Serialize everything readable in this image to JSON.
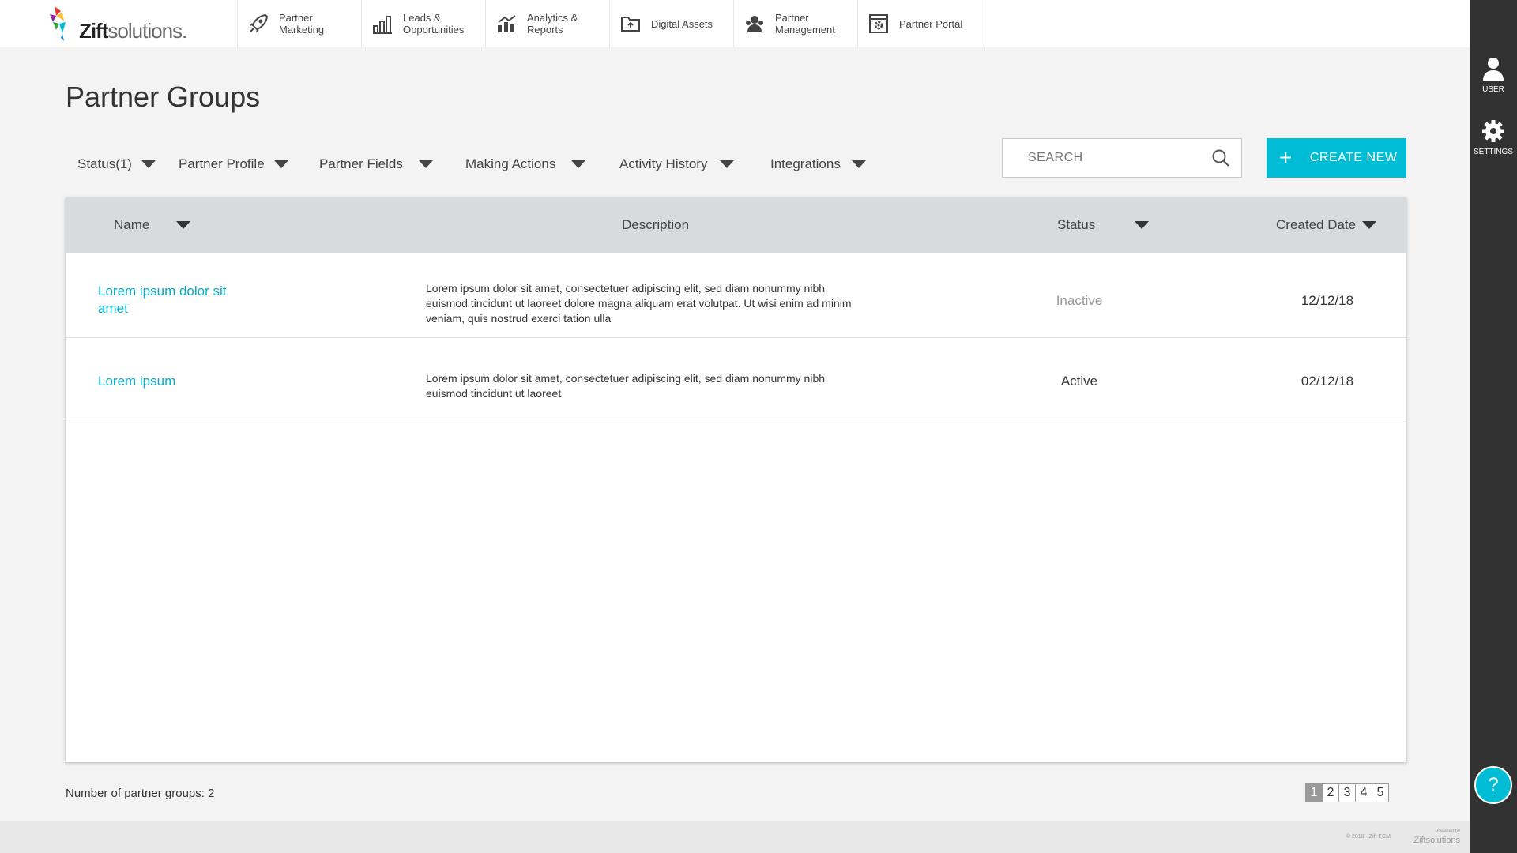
{
  "brand": {
    "name_bold": "Zift",
    "name_rest": "solutions."
  },
  "nav": [
    {
      "label": "Partner Marketing",
      "icon": "rocket-icon"
    },
    {
      "label": "Leads & Opportunities",
      "icon": "leads-chart-icon"
    },
    {
      "label": "Analytics & Reports",
      "icon": "analytics-icon"
    },
    {
      "label": "Digital Assets",
      "icon": "folder-upload-icon"
    },
    {
      "label": "Partner Management",
      "icon": "people-icon"
    },
    {
      "label": "Partner Portal",
      "icon": "portal-gear-icon"
    }
  ],
  "sidebar": {
    "user_label": "USER",
    "settings_label": "SETTINGS",
    "help_glyph": "?"
  },
  "page": {
    "title": "Partner Groups"
  },
  "filters": [
    "Status(1)",
    "Partner Profile",
    "Partner Fields",
    "Making Actions",
    "Activity History",
    "Integrations"
  ],
  "search": {
    "placeholder": "SEARCH"
  },
  "create_button": {
    "plus": "+",
    "label": "CREATE NEW"
  },
  "table": {
    "headers": {
      "name": "Name",
      "description": "Description",
      "status": "Status",
      "created": "Created Date"
    },
    "rows": [
      {
        "name": "Lorem ipsum dolor sit amet",
        "description": "Lorem ipsum dolor sit amet, consectetuer adipiscing elit, sed diam nonummy nibh euismod tincidunt ut laoreet dolore magna aliquam erat volutpat. Ut wisi enim ad minim veniam, quis nostrud exerci tation ulla",
        "status": "Inactive",
        "status_color": "#999999",
        "date": "12/12/18"
      },
      {
        "name": "Lorem ipsum",
        "description": "Lorem ipsum dolor sit amet, consectetuer adipiscing elit, sed diam nonummy nibh euismod tincidunt ut laoreet",
        "status": "Active",
        "status_color": "#333333",
        "date": "02/12/18"
      }
    ]
  },
  "footer_summary": {
    "count_text": "Number of partner groups: 2"
  },
  "pagination": {
    "pages": [
      "1",
      "2",
      "3",
      "4",
      "5"
    ],
    "active": "1"
  },
  "footer": {
    "copyright": "© 2018 - Zift ECM",
    "powered_by": "Powered by",
    "powered_brand": "Ziftsolutions"
  },
  "colors": {
    "accent": "#00bcd4",
    "link": "#00aecb",
    "sidebar": "#323232"
  }
}
